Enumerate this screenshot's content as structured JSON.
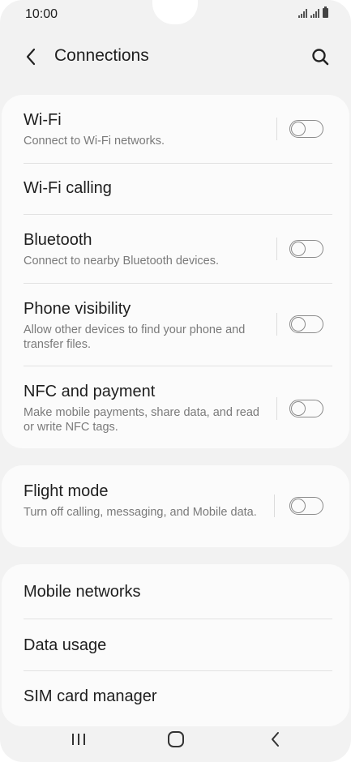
{
  "status": {
    "time": "10:00"
  },
  "header": {
    "title": "Connections"
  },
  "group1": {
    "wifi": {
      "title": "Wi-Fi",
      "subtitle": "Connect to Wi-Fi networks."
    },
    "wifi_calling": {
      "title": "Wi-Fi calling"
    },
    "bluetooth": {
      "title": "Bluetooth",
      "subtitle": "Connect to nearby Bluetooth devices."
    },
    "phone_visibility": {
      "title": "Phone visibility",
      "subtitle": "Allow other devices to find your phone and transfer files."
    },
    "nfc": {
      "title": "NFC and payment",
      "subtitle": "Make mobile payments, share data, and read or write NFC tags."
    }
  },
  "group2": {
    "flight_mode": {
      "title": "Flight mode",
      "subtitle": "Turn off calling, messaging, and Mobile data."
    }
  },
  "group3": {
    "mobile_networks": {
      "title": "Mobile networks"
    },
    "data_usage": {
      "title": "Data usage"
    },
    "sim_manager": {
      "title": "SIM card manager"
    }
  },
  "toggles": {
    "wifi": false,
    "bluetooth": false,
    "phone_visibility": false,
    "nfc": false,
    "flight_mode": false
  },
  "colors": {
    "background": "#f2f2f2",
    "card": "#fbfbfb",
    "text": "#1e1e1e",
    "subtext": "#7a7a7a",
    "toggle_off": "#8a8a8a"
  }
}
